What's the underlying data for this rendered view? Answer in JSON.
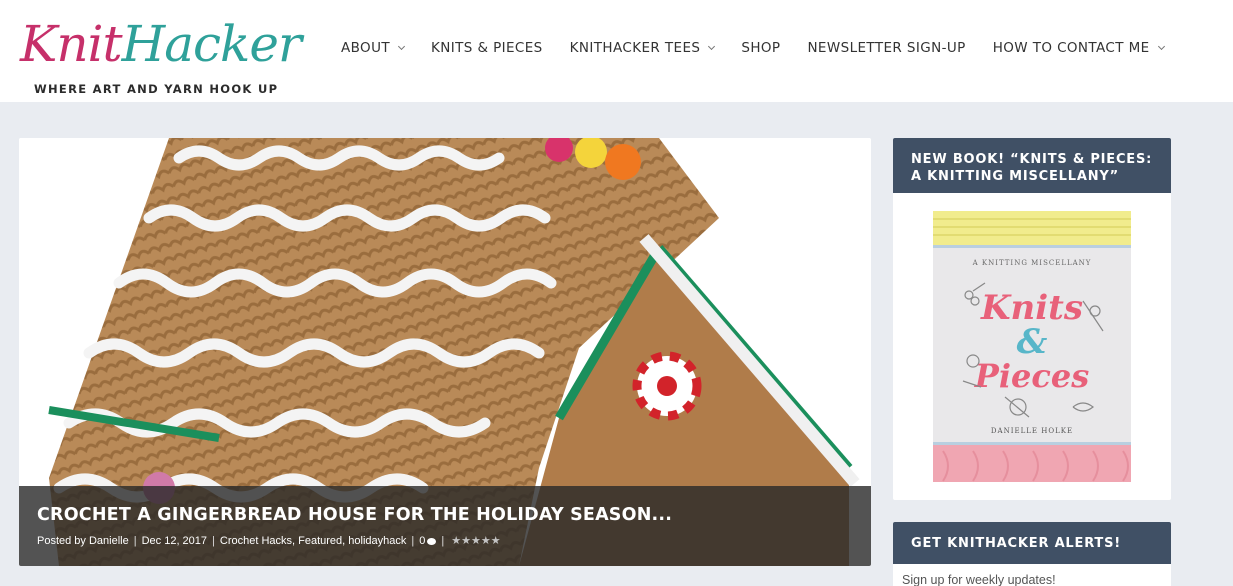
{
  "header": {
    "logo": {
      "word1": "Knit",
      "word2": "Hacker",
      "tagline": "WHERE ART AND YARN HOOK UP"
    },
    "nav": [
      {
        "label": "ABOUT",
        "has_dropdown": true
      },
      {
        "label": "KNITS & PIECES",
        "has_dropdown": false
      },
      {
        "label": "KNITHACKER TEES",
        "has_dropdown": true
      },
      {
        "label": "SHOP",
        "has_dropdown": false
      },
      {
        "label": "NEWSLETTER SIGN-UP",
        "has_dropdown": false
      },
      {
        "label": "HOW TO CONTACT ME",
        "has_dropdown": true
      }
    ]
  },
  "featured_post": {
    "title": "CROCHET A GINGERBREAD HOUSE FOR THE HOLIDAY SEASON...",
    "meta": {
      "posted_by_prefix": "Posted by",
      "author": "Danielle",
      "date": "Dec 12, 2017",
      "categories": "Crochet Hacks, Featured, holidayhack",
      "comment_count": "0",
      "rating_stars": 5
    }
  },
  "sidebar": {
    "book_widget": {
      "title": "NEW BOOK! “KNITS & PIECES: A KNITTING MISCELLANY”",
      "cover": {
        "subtitle": "A KNITTING MISCELLANY",
        "title_line1": "Knits",
        "title_amp": "&",
        "title_line2": "Pieces",
        "author": "DANIELLE HOLKE"
      }
    },
    "alerts_widget": {
      "title": "GET KNITHACKER ALERTS!",
      "text": "Sign up for weekly updates!"
    }
  },
  "colors": {
    "logo_pink": "#c6306a",
    "logo_teal": "#2fa19a",
    "widget_header": "#405065",
    "page_bg": "#e9ecf1"
  }
}
